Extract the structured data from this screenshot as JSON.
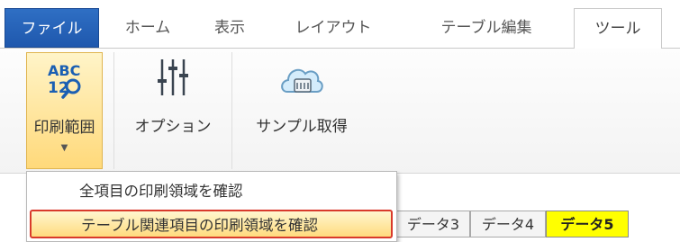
{
  "ribbon": {
    "tabs": [
      {
        "label": "ファイル"
      },
      {
        "label": "ホーム"
      },
      {
        "label": "表示"
      },
      {
        "label": "レイアウト"
      },
      {
        "label": "テーブル編集"
      },
      {
        "label": "ツール"
      }
    ],
    "active_tab": "ツール"
  },
  "toolbar": {
    "print_range": {
      "label": "印刷範囲",
      "icon": "abc-123-magnify-icon",
      "icon_text_top": "ABC",
      "icon_text_bottom": "12"
    },
    "options": {
      "label": "オプション",
      "icon": "sliders-icon"
    },
    "sample": {
      "label": "サンプル取得",
      "icon": "cloud-database-icon"
    }
  },
  "dropdown": {
    "items": [
      {
        "label": "全項目の印刷領域を確認"
      },
      {
        "label": "テーブル関連項目の印刷領域を確認",
        "highlighted": true
      }
    ]
  },
  "sheets": {
    "tabs": [
      {
        "label": "データ3"
      },
      {
        "label": "データ4"
      },
      {
        "label": "データ5",
        "active": true
      }
    ]
  },
  "colors": {
    "file_tab": "#1f58ad",
    "highlight": "#ffdb7e",
    "highlight_border": "#d93a2b",
    "active_sheet": "#ffff00"
  }
}
